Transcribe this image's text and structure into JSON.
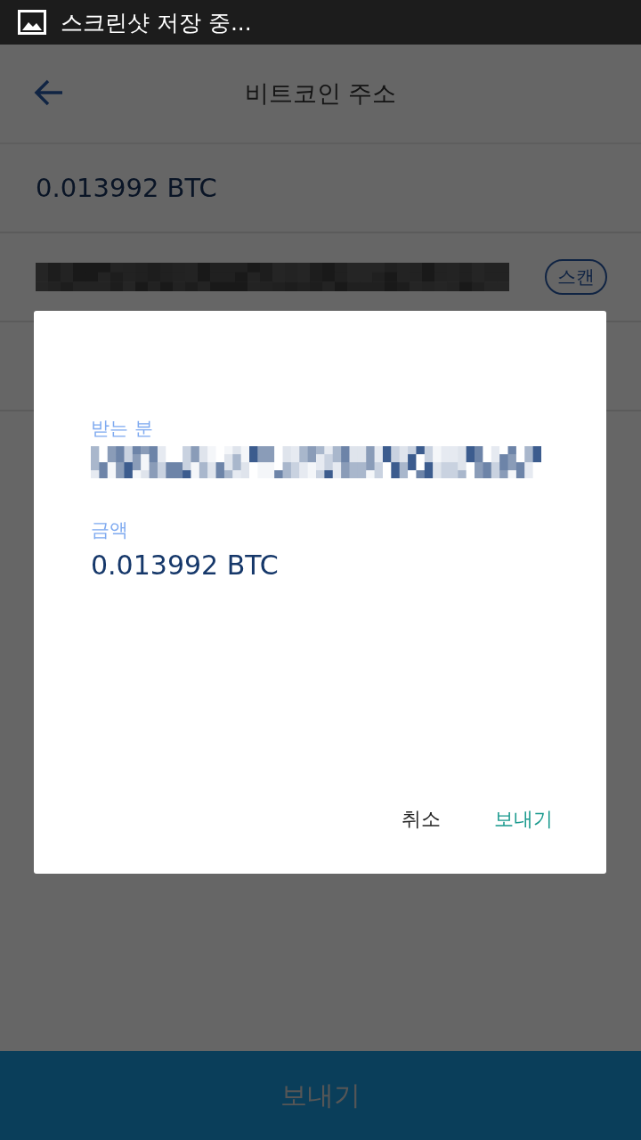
{
  "status_bar": {
    "notification": "스크린샷 저장 중..."
  },
  "header": {
    "title": "비트코인 주소"
  },
  "amount_row": {
    "value": "0.013992 BTC"
  },
  "address_row": {
    "scan_button": "스캔"
  },
  "send_button": {
    "label": "보내기"
  },
  "dialog": {
    "recipient_label": "받는 분",
    "amount_label": "금액",
    "amount": "0.013992 BTC",
    "buttons": [
      {
        "label": "취소",
        "kind": "neutral"
      },
      {
        "label": "보내기",
        "kind": "primary"
      }
    ]
  }
}
